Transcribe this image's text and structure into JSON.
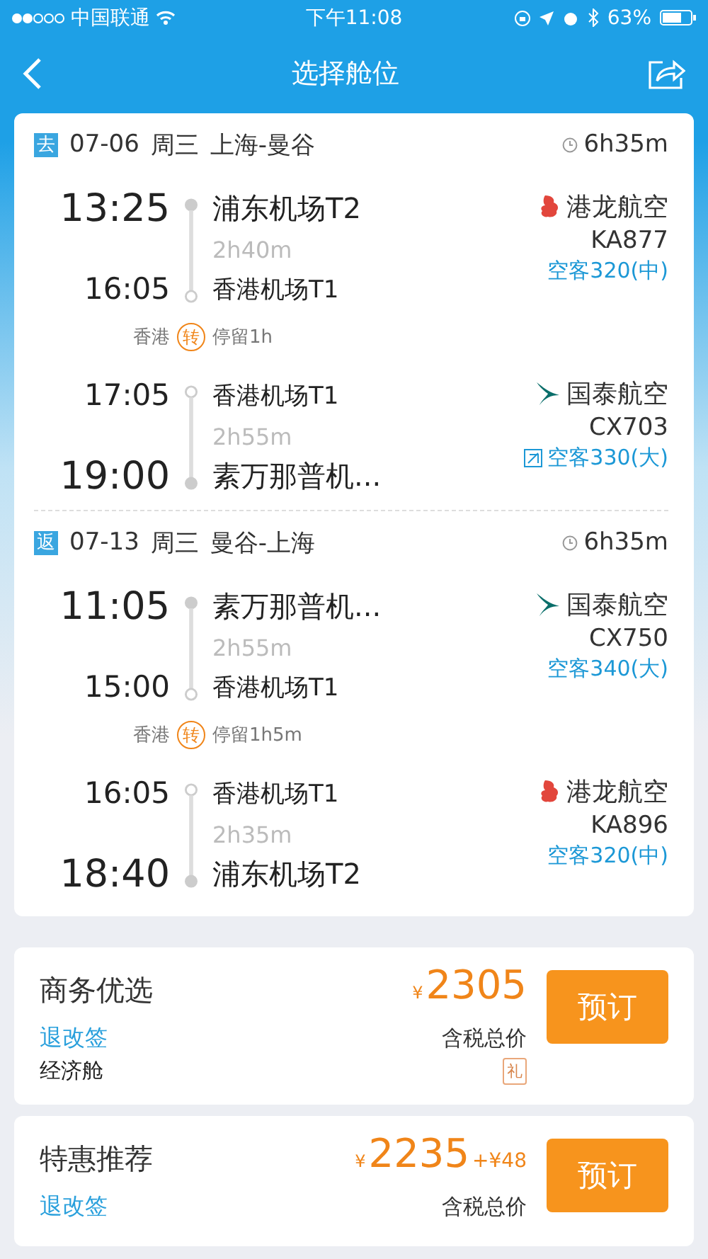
{
  "status_bar": {
    "carrier": "中国联通",
    "time": "下午11:08",
    "battery": "63%"
  },
  "nav": {
    "title": "选择舱位"
  },
  "trips": [
    {
      "tag": "去",
      "date": "07-06",
      "weekday": "周三",
      "route": "上海-曼谷",
      "duration": "6h35m",
      "transfer": {
        "city": "香港",
        "badge": "转",
        "stay": "停留1h"
      },
      "segments": [
        {
          "dep_time": "13:25",
          "dep_airport": "浦东机场T2",
          "flight_duration": "2h40m",
          "arr_time": "16:05",
          "arr_airport": "香港机场T1",
          "kind": "dragon",
          "airline": "港龙航空",
          "flight_no": "KA877",
          "aircraft": "空客320(中)",
          "aircraft_icon": false
        },
        {
          "dep_time": "17:05",
          "dep_airport": "香港机场T1",
          "flight_duration": "2h55m",
          "arr_time": "19:00",
          "arr_airport": "素万那普机...",
          "kind": "swoosh",
          "airline": "国泰航空",
          "flight_no": "CX703",
          "aircraft": "空客330(大)",
          "aircraft_icon": true
        }
      ]
    },
    {
      "tag": "返",
      "date": "07-13",
      "weekday": "周三",
      "route": "曼谷-上海",
      "duration": "6h35m",
      "transfer": {
        "city": "香港",
        "badge": "转",
        "stay": "停留1h5m"
      },
      "segments": [
        {
          "dep_time": "11:05",
          "dep_airport": "素万那普机...",
          "flight_duration": "2h55m",
          "arr_time": "15:00",
          "arr_airport": "香港机场T1",
          "kind": "swoosh",
          "airline": "国泰航空",
          "flight_no": "CX750",
          "aircraft": "空客340(大)",
          "aircraft_icon": false
        },
        {
          "dep_time": "16:05",
          "dep_airport": "香港机场T1",
          "flight_duration": "2h35m",
          "arr_time": "18:40",
          "arr_airport": "浦东机场T2",
          "kind": "dragon",
          "airline": "港龙航空",
          "flight_no": "KA896",
          "aircraft": "空客320(中)",
          "aircraft_icon": false
        }
      ]
    }
  ],
  "offers": [
    {
      "name": "商务优选",
      "rules": "退改签",
      "currency": "¥",
      "price": "2305",
      "price_note": "含税总价",
      "cabin": "经济舱",
      "gift": "礼",
      "button": "预订"
    },
    {
      "name": "特惠推荐",
      "rules": "退改签",
      "currency": "¥",
      "price": "2235",
      "extra": "+¥48",
      "price_note": "含税总价",
      "button": "预订"
    }
  ]
}
